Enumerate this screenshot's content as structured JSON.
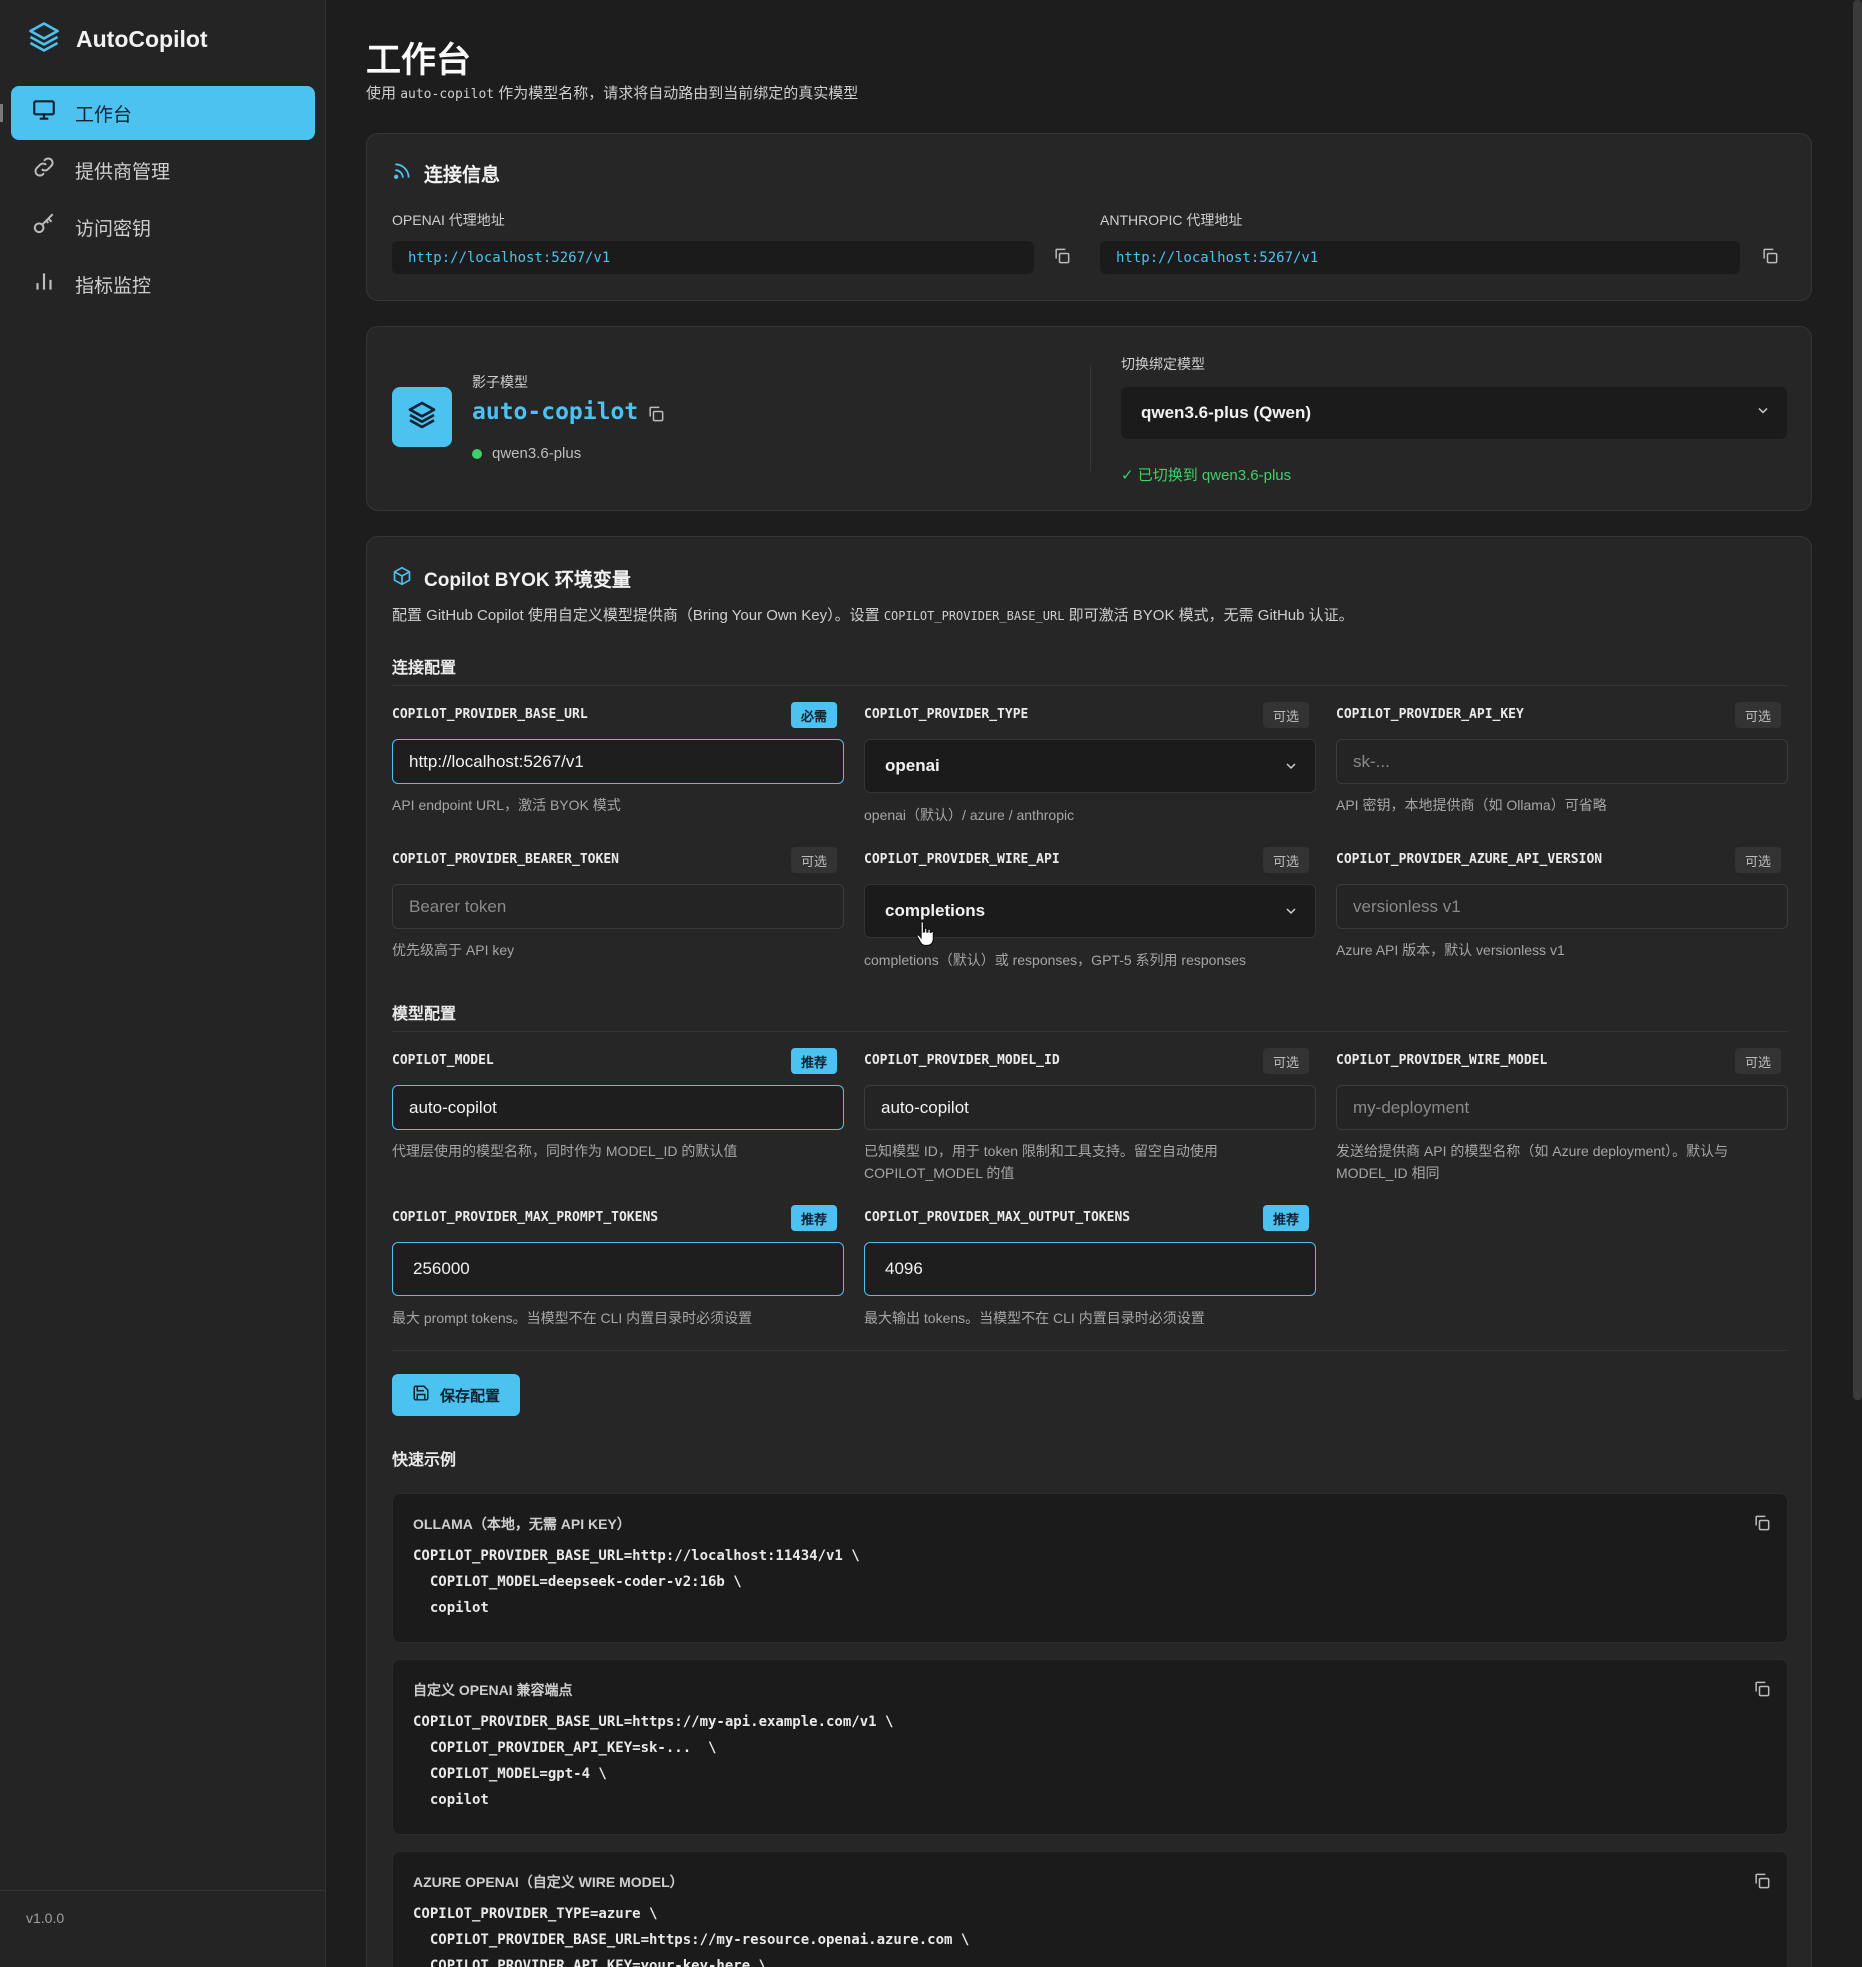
{
  "app": {
    "name": "AutoCopilot",
    "version": "v1.0.0"
  },
  "sidebar": {
    "items": [
      {
        "label": "工作台"
      },
      {
        "label": "提供商管理"
      },
      {
        "label": "访问密钥"
      },
      {
        "label": "指标监控"
      }
    ]
  },
  "header": {
    "title": "工作台",
    "sub_prefix": "使用",
    "sub_code": "auto-copilot",
    "sub_suffix": "作为模型名称，请求将自动路由到当前绑定的真实模型"
  },
  "connection": {
    "title": "连接信息",
    "openai_label": "OPENAI 代理地址",
    "openai_url": "http://localhost:5267/v1",
    "anthropic_label": "ANTHROPIC 代理地址",
    "anthropic_url": "http://localhost:5267/v1"
  },
  "shadow": {
    "label": "影子模型",
    "name": "auto-copilot",
    "bound": "qwen3.6-plus",
    "switch_label": "切换绑定模型",
    "selected": "qwen3.6-plus (Qwen)",
    "status": "✓ 已切换到 qwen3.6-plus"
  },
  "byok": {
    "title": "Copilot BYOK 环境变量",
    "desc_prefix": "配置 GitHub Copilot 使用自定义模型提供商（Bring Your Own Key）。设置",
    "desc_code": "COPILOT_PROVIDER_BASE_URL",
    "desc_suffix": "即可激活 BYOK 模式，无需 GitHub 认证。",
    "section_conn": "连接配置",
    "section_model": "模型配置",
    "save": "保存配置",
    "quick": "快速示例"
  },
  "tags": {
    "required": "必需",
    "optional": "可选",
    "recommended": "推荐"
  },
  "fields": {
    "base_url": {
      "label": "COPILOT_PROVIDER_BASE_URL",
      "value": "http://localhost:5267/v1",
      "help": "API endpoint URL，激活 BYOK 模式"
    },
    "type": {
      "label": "COPILOT_PROVIDER_TYPE",
      "value": "openai",
      "help": "openai（默认）/ azure / anthropic"
    },
    "api_key": {
      "label": "COPILOT_PROVIDER_API_KEY",
      "placeholder": "sk-...",
      "help": "API 密钥，本地提供商（如 Ollama）可省略"
    },
    "bearer": {
      "label": "COPILOT_PROVIDER_BEARER_TOKEN",
      "placeholder": "Bearer token",
      "help": "优先级高于 API key"
    },
    "wire_api": {
      "label": "COPILOT_PROVIDER_WIRE_API",
      "value": "completions",
      "help": "completions（默认）或 responses，GPT-5 系列用 responses"
    },
    "azure_ver": {
      "label": "COPILOT_PROVIDER_AZURE_API_VERSION",
      "placeholder": "versionless v1",
      "help": "Azure API 版本，默认 versionless v1"
    },
    "model": {
      "label": "COPILOT_MODEL",
      "value": "auto-copilot",
      "help": "代理层使用的模型名称，同时作为 MODEL_ID 的默认值"
    },
    "model_id": {
      "label": "COPILOT_PROVIDER_MODEL_ID",
      "value": "auto-copilot",
      "help1": "已知模型 ID，用于 token 限制和工具支持。留空自动使用",
      "help2": "COPILOT_MODEL 的值"
    },
    "wire_model": {
      "label": "COPILOT_PROVIDER_WIRE_MODEL",
      "placeholder": "my-deployment",
      "help1": "发送给提供商 API 的模型名称（如 Azure deployment）。默认与",
      "help2": "MODEL_ID 相同"
    },
    "max_prompt": {
      "label": "COPILOT_PROVIDER_MAX_PROMPT_TOKENS",
      "value": "256000",
      "help": "最大 prompt tokens。当模型不在 CLI 内置目录时必须设置"
    },
    "max_output": {
      "label": "COPILOT_PROVIDER_MAX_OUTPUT_TOKENS",
      "value": "4096",
      "help": "最大输出 tokens。当模型不在 CLI 内置目录时必须设置"
    }
  },
  "examples": [
    {
      "title": "OLLAMA（本地，无需 API KEY）",
      "lines": [
        "COPILOT_PROVIDER_BASE_URL=http://localhost:11434/v1 \\",
        "  COPILOT_MODEL=deepseek-coder-v2:16b \\",
        "  copilot"
      ]
    },
    {
      "title": "自定义 OPENAI 兼容端点",
      "lines": [
        "COPILOT_PROVIDER_BASE_URL=https://my-api.example.com/v1 \\",
        "  COPILOT_PROVIDER_API_KEY=sk-...  \\",
        "  COPILOT_MODEL=gpt-4 \\",
        "  copilot"
      ]
    },
    {
      "title": "AZURE OPENAI（自定义 WIRE MODEL）",
      "lines": [
        "COPILOT_PROVIDER_TYPE=azure \\",
        "  COPILOT_PROVIDER_BASE_URL=https://my-resource.openai.azure.com \\",
        "  COPILOT_PROVIDER_API_KEY=your-key-here \\"
      ]
    }
  ],
  "colors": {
    "accent": "#4cc2f1",
    "success": "#3fd06a",
    "bg": "#1d1d1d",
    "card": "#262626"
  }
}
